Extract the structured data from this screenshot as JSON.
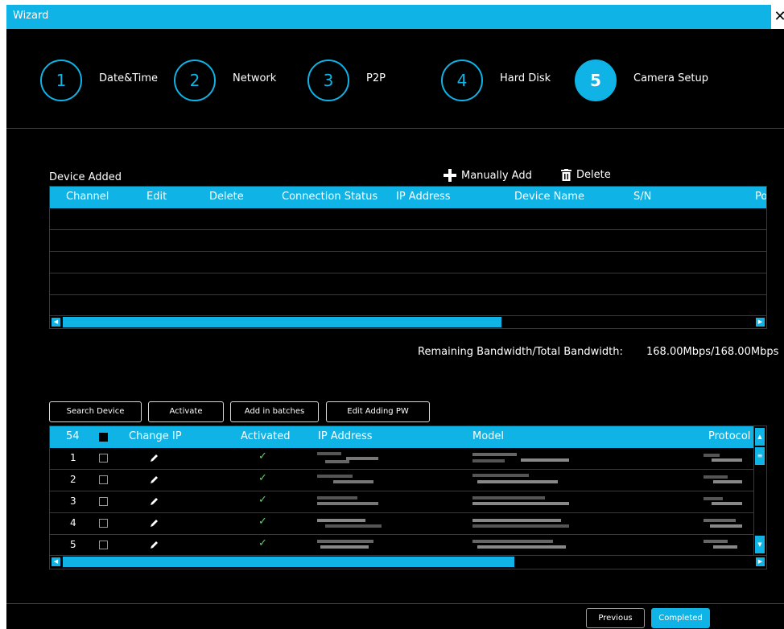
{
  "window": {
    "title": "Wizard",
    "close_glyph": "✕"
  },
  "steps": [
    {
      "num": "1",
      "label": "Date&Time",
      "active": false
    },
    {
      "num": "2",
      "label": "Network",
      "active": false
    },
    {
      "num": "3",
      "label": "P2P",
      "active": false
    },
    {
      "num": "4",
      "label": "Hard Disk",
      "active": false
    },
    {
      "num": "5",
      "label": "Camera Setup",
      "active": true
    }
  ],
  "added": {
    "title": "Device Added",
    "manually_add": "Manually Add",
    "delete": "Delete",
    "columns": [
      "Channel",
      "Edit",
      "Delete",
      "Connection Status",
      "IP Address",
      "Device Name",
      "S/N",
      "Po"
    ]
  },
  "bandwidth": {
    "label": "Remaining Bandwidth/Total Bandwidth:",
    "value": "168.00Mbps/168.00Mbps"
  },
  "buttons": {
    "search": "Search Device",
    "activate": "Activate",
    "add_batches": "Add in batches",
    "edit_pw": "Edit Adding PW"
  },
  "search": {
    "count": "54",
    "columns": [
      "Change IP",
      "Activated",
      "IP Address",
      "Model",
      "Protocol"
    ],
    "rows": [
      {
        "num": "1"
      },
      {
        "num": "2"
      },
      {
        "num": "3"
      },
      {
        "num": "4"
      },
      {
        "num": "5"
      }
    ]
  },
  "footer": {
    "previous": "Previous",
    "completed": "Completed"
  },
  "colors": {
    "accent": "#0fb3e6",
    "check": "#5fd16d"
  },
  "icons": [
    "close-icon",
    "plus-icon",
    "trash-icon",
    "pencil-icon",
    "check-icon"
  ]
}
